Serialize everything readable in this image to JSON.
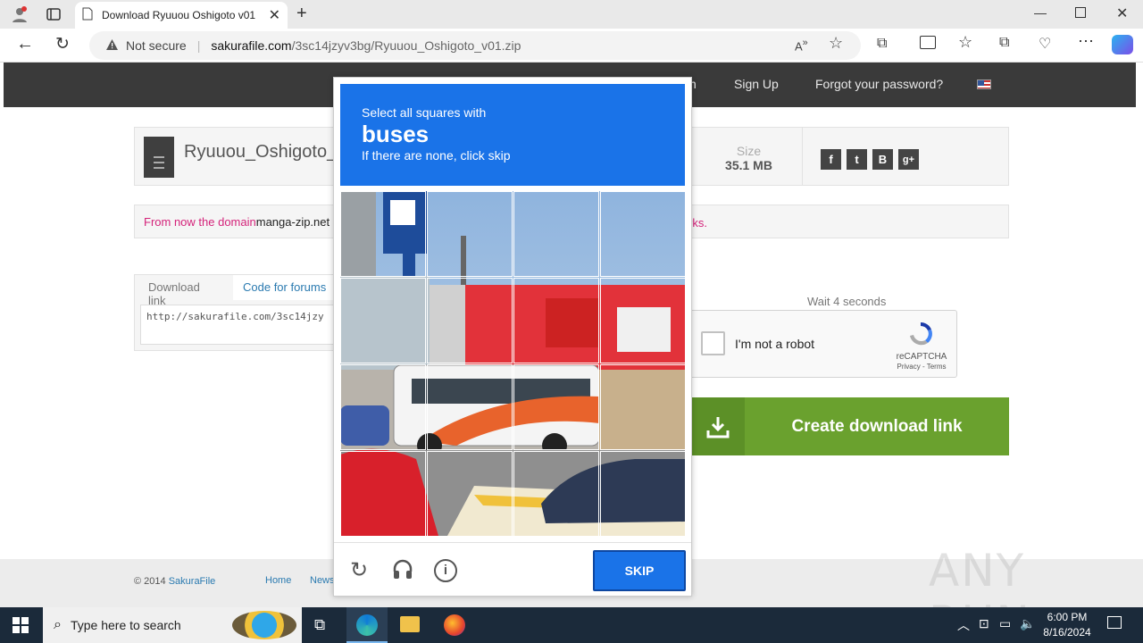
{
  "browser": {
    "tab_title": "Download Ryuuou Oshigoto v01",
    "security_label": "Not secure",
    "url_domain": "sakurafile.com",
    "url_path": "/3sc14jzyv3bg/Ryuuou_Oshigoto_v01.zip"
  },
  "site": {
    "nav": {
      "partial": "n",
      "signup": "Sign Up",
      "forgot": "Forgot your password?"
    },
    "file_name": "Ryuuou_Oshigoto_v",
    "size_label": "Size",
    "size_value": "35.1 MB",
    "social": [
      "f",
      "t",
      "B",
      "g+"
    ],
    "notice_prefix": "From now the domain ",
    "notice_domain": "manga-zip.net",
    "notice_suffix": "rks.",
    "tabs": [
      "Download link",
      "Code for forums"
    ],
    "link_value": "http://sakurafile.com/3sc14jzy",
    "wait_text": "Wait 4 seconds",
    "recaptcha_label": "I'm not a robot",
    "recaptcha_brand": "reCAPTCHA",
    "recaptcha_links": "Privacy - Terms",
    "create_label": "Create download link",
    "footer_copy": "© 2014 ",
    "footer_brand": "SakuraFile",
    "footer_links": [
      "Home",
      "News"
    ]
  },
  "challenge": {
    "line1": "Select all squares with",
    "target": "buses",
    "line3": "If there are none, click skip",
    "skip_label": "SKIP"
  },
  "taskbar": {
    "search_placeholder": "Type here to search",
    "time": "6:00 PM",
    "date": "8/16/2024"
  },
  "watermark": "ANY RUN",
  "colors": {
    "captcha_blue": "#1a73e8",
    "create_green": "#6aa12e",
    "notice_magenta": "#d4237a"
  }
}
